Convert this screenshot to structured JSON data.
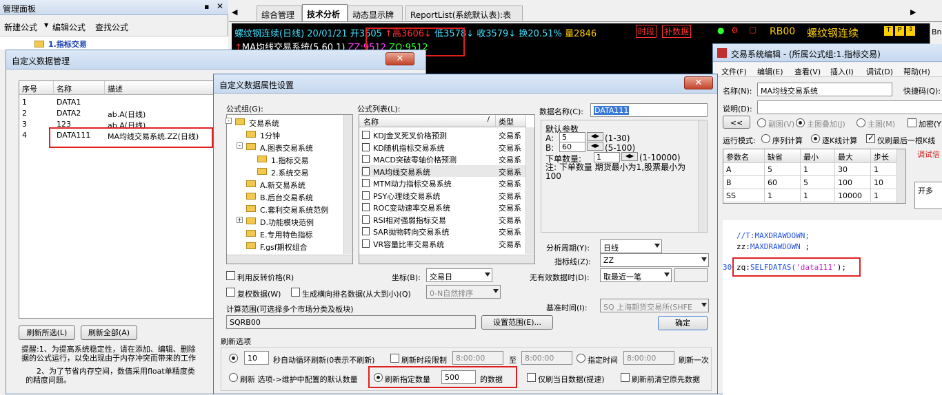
{
  "left_panel": {
    "title": "管理面板",
    "pin_icon": "pin-icon",
    "close_icon": "close-icon",
    "toolbar": [
      "新建公式",
      "编辑公式",
      "查找公式"
    ],
    "tree_item": "1.指标交易"
  },
  "tabs": [
    "综合管理",
    "技术分析",
    "动态显示牌",
    "ReportList(系统默认表):表"
  ],
  "quote": {
    "line1": "螺纹钢连续(日线) 20/01/21 开3605",
    "high": "高3606",
    "low": "低3578",
    "close": "收3579",
    "turnover": "换20.51%",
    "vol": "量2846",
    "btn_period": "时段",
    "btn_fill": "补数据",
    "symbol": "RB00",
    "name": "螺纹钢连续",
    "line2": "MA均线交易系统(5,60,1)",
    "zz": "ZZ:9512",
    "zq": "ZQ:9512"
  },
  "data_mgr": {
    "title": "自定义数据管理",
    "headers": [
      "序号",
      "名称",
      "描述"
    ],
    "rows": [
      [
        "1",
        "DATA1",
        ""
      ],
      [
        "2",
        "DATA2",
        "ab.A(日线)"
      ],
      [
        "3",
        "123",
        "ab.A(日线)"
      ],
      [
        "4",
        "DATA111",
        "MA均线交易系统.ZZ(日线)"
      ]
    ],
    "btn_refresh_sel": "刷新所选(L)",
    "btn_refresh_all": "刷新全部(A)",
    "note1": "提醒:1、为提高系统稳定性，请在添加、编辑、删除",
    "note2": "据的公式运行，以免出现由于内存冲突而带来的工作",
    "note3": "2、为了节省内存空间，数值采用float单精度类",
    "note4": "的精度问题。"
  },
  "prop": {
    "title": "自定义数据属性设置",
    "group_label": "公式组(G):",
    "group_tree": [
      {
        "t": "交易系统",
        "lv": 0,
        "exp": "-"
      },
      {
        "t": "1分钟",
        "lv": 1
      },
      {
        "t": "A.图表交易系统",
        "lv": 1,
        "exp": "-"
      },
      {
        "t": "1.指标交易",
        "lv": 2
      },
      {
        "t": "2.系统交易",
        "lv": 2
      },
      {
        "t": "A.新交易系统",
        "lv": 1
      },
      {
        "t": "B.后台交易系统",
        "lv": 1
      },
      {
        "t": "C.套利交易系统范例",
        "lv": 1
      },
      {
        "t": "D.功能模块范例",
        "lv": 1,
        "exp": "+"
      },
      {
        "t": "E.专用特色指标",
        "lv": 1
      },
      {
        "t": "F.gsf期权组合",
        "lv": 1
      }
    ],
    "list_label": "公式列表(L):",
    "list_headers": [
      "名称",
      "类型"
    ],
    "list": [
      [
        "KDJ金叉死叉价格预测",
        "交易系"
      ],
      [
        "KD随机指标交易系统",
        "交易系"
      ],
      [
        "MACD突破零轴价格预测",
        "交易系"
      ],
      [
        "MA均线交易系统",
        "交易系"
      ],
      [
        "MTM动力指标交易系统",
        "交易系"
      ],
      [
        "PSY心理线交易系统",
        "交易系"
      ],
      [
        "ROC变动速率交易系统",
        "交易系"
      ],
      [
        "RSI相对强弱指标交易",
        "交易系"
      ],
      [
        "SAR抛物转向交易系统",
        "交易系"
      ],
      [
        "VR容量比率交易系统",
        "交易系"
      ]
    ],
    "name_label": "数据名称(C):",
    "name_value": "DATA111",
    "params_title": "默认参数",
    "paramA": "A:",
    "paramA_val": "5",
    "paramA_range": "(1-30)",
    "paramB": "B:",
    "paramB_val": "60",
    "paramB_range": "(5-100)",
    "order_label": "下单数量:",
    "order_val": "1",
    "order_range": "(1-10000)",
    "note": "注: 下单数量 期货最小为1,股票最小为100",
    "cycle_label": "分析周期(Y):",
    "cycle": "日线",
    "indicator_label": "指标线(Z):",
    "indicator": "ZZ",
    "reverse_label": "利用反转价格(R)",
    "coord_label": "坐标(B):",
    "coord": "交易日",
    "invalid_label": "无有效数据时(D):",
    "invalid": "取最近一笔",
    "copy_label": "复权数据(W)",
    "sort_label": "生成横向排名数据(从大到小)(Q)",
    "sort_val": "0-N自然排序",
    "base_time_label": "基准时间(I):",
    "base_time": "SQ 上海期货交易所(SHFE",
    "range_label": "计算范围(可选择多个市场分类及板块)",
    "range_val": "SQRB00",
    "range_btn": "设置范围(E)...",
    "ok_btn": "确定",
    "refresh_title": "刷新选项",
    "auto_val": "10",
    "auto_label": "秒自动循环刷新(0表示不刷新)",
    "period_limit_label": "刷新时段限制",
    "t1": "8:00:00",
    "to": "至",
    "t2": "8:00:00",
    "specify_time_label": "指定时间",
    "t3": "8:00:00",
    "refresh_once": "刷新一次",
    "refresh_opt_label": "刷新 选项->维护中配置的默认数量",
    "refresh_count_label": "刷新指定数量",
    "refresh_count": "500",
    "refresh_count_suffix": "的数据",
    "only_today": "仅刷当日数据(提速)",
    "clear_before": "刷新前清空原先数据"
  },
  "editor": {
    "title": "交易系统编辑 - (所属公式组:1.指标交易)",
    "menu": [
      "文件(F)",
      "编辑(E)",
      "查看(V)",
      "插入(I)",
      "调试(D)",
      "帮助(H)"
    ],
    "name_label": "名称(N):",
    "name_val": "MA均线交易系统",
    "shortcut_label": "快捷码(Q):",
    "desc_label": "说明(D):",
    "nav_btn": "<<",
    "r1": "副图(V)",
    "r2": "主图叠加(J)",
    "r3": "主图(M)",
    "encrypt": "加密(Y)",
    "mode_label": "运行模式:",
    "m1": "序列计算",
    "m2": "逐K线计算",
    "last_only": "仅刷最后一根K线",
    "param_headers": [
      "参数名",
      "缺省",
      "最小",
      "最大",
      "步长"
    ],
    "params": [
      [
        "A",
        "5",
        "1",
        "30",
        "1"
      ],
      [
        "B",
        "60",
        "5",
        "100",
        "10"
      ],
      [
        "SS",
        "1",
        "1",
        "10000",
        "1"
      ]
    ],
    "debug": "调试信",
    "open": "开多",
    "code1": "//T:MAXDRAWDOWN;",
    "code2a": "zz:",
    "code2b": "MAXDRAWDOWN",
    "code2c": " ;",
    "linenum": "30",
    "code3a": "zq:",
    "code3b": "SELFDATAS(",
    "code3c": "'data111'",
    "code3d": ");"
  },
  "colors": {
    "chart_bg": "#000000",
    "red": "#ff3030",
    "cyan": "#40e0ff",
    "green": "#30ff30",
    "yellow": "#ffd000",
    "magenta": "#ff40ff",
    "highlight": "#e02020"
  }
}
